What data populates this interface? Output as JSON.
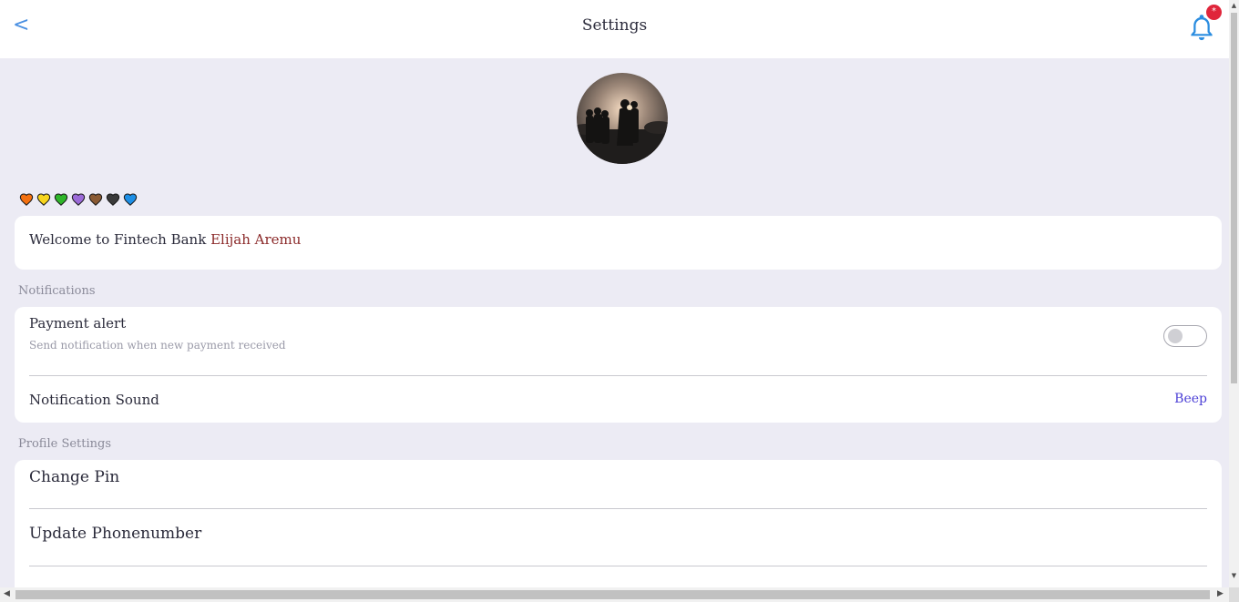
{
  "header": {
    "back_label": "<",
    "title": "Settings",
    "badge": "*"
  },
  "hearts": [
    {
      "name": "orange-heart-icon",
      "color": "#f4700f"
    },
    {
      "name": "yellow-heart-icon",
      "color": "#f7d51d"
    },
    {
      "name": "green-heart-icon",
      "color": "#2fb62a"
    },
    {
      "name": "purple-heart-icon",
      "color": "#9b6ad8"
    },
    {
      "name": "brown-heart-icon",
      "color": "#8a5a33"
    },
    {
      "name": "black-heart-icon",
      "color": "#3a3a3a"
    },
    {
      "name": "blue-heart-icon",
      "color": "#1d8fe6"
    }
  ],
  "welcome": {
    "prefix": "Welcome to Fintech Bank",
    "name": "Elijah Aremu"
  },
  "notifications": {
    "section_label": "Notifications",
    "payment_alert": {
      "title": "Payment alert",
      "subtitle": "Send notification when new payment received",
      "enabled": false
    },
    "sound": {
      "title": "Notification Sound",
      "value": "Beep"
    }
  },
  "profile_settings": {
    "section_label": "Profile Settings",
    "items": [
      "Change Pin",
      "Update Phonenumber"
    ]
  },
  "colors": {
    "background": "#ecebf4",
    "accent_link": "#4b3fd6",
    "name_color": "#8b2a2a",
    "bell_color": "#2b8de0",
    "badge_color": "#e0253b"
  }
}
